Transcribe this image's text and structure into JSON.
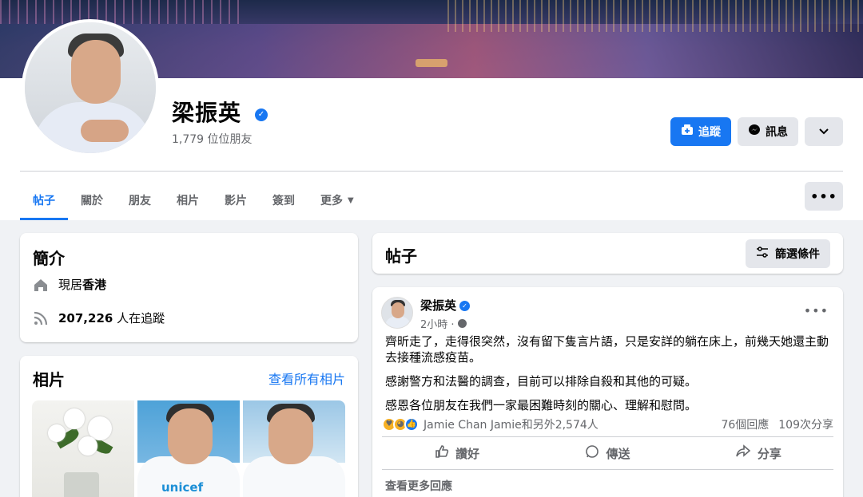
{
  "profile": {
    "name": "梁振英",
    "friends": "1,779 位位朋友"
  },
  "buttons": {
    "follow": "追蹤",
    "message": "訊息"
  },
  "tabs": [
    {
      "label": "帖子"
    },
    {
      "label": "關於"
    },
    {
      "label": "朋友"
    },
    {
      "label": "相片"
    },
    {
      "label": "影片"
    },
    {
      "label": "簽到"
    },
    {
      "label": "更多"
    }
  ],
  "intro": {
    "title": "簡介",
    "lives_prefix": "現居",
    "lives_place": "香港",
    "followers_count": "207,226",
    "followers_suffix": " 人在追蹤"
  },
  "photos": {
    "title": "相片",
    "see_all": "查看所有相片",
    "unicef_text": "unicef"
  },
  "posts_header": {
    "title": "帖子",
    "filter": "篩選條件"
  },
  "post": {
    "author": "梁振英",
    "time": "2小時 ·",
    "paragraphs": [
      "齊昕走了，走得很突然，沒有留下隻言片語，只是安詳的躺在床上，前幾天她還主動去接種流感疫苗。",
      "感謝警方和法醫的調查，目前可以排除自殺和其他的可疑。",
      "感恩各位朋友在我們一家最困難時刻的關心、理解和慰問。"
    ],
    "reactions_text": "Jamie Chan Jamie和另外2,574人",
    "comments": "76個回應",
    "shares": "109次分享",
    "actions": {
      "like": "讚好",
      "send": "傳送",
      "share": "分享"
    },
    "more_comments": "查看更多回應"
  },
  "colors": {
    "accent": "#1877f2",
    "page_bg": "#f0f2f5",
    "secondary_text": "#65676b"
  }
}
